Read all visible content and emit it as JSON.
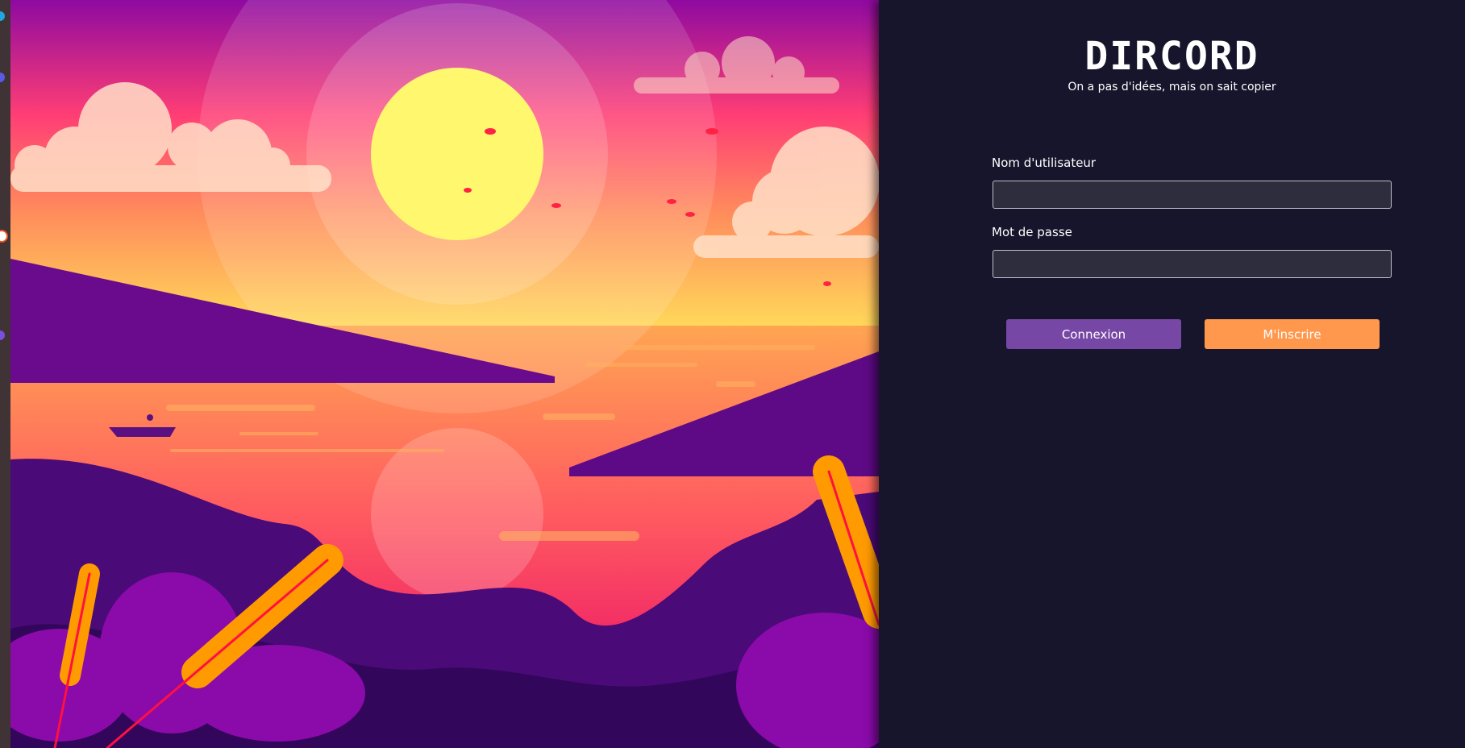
{
  "app": {
    "title": "DIRCORD",
    "tagline": "On a pas d'idées, mais on sait copier"
  },
  "login_form": {
    "username_label": "Nom d'utilisateur",
    "username_value": "",
    "password_label": "Mot de passe",
    "password_value": "",
    "login_button": "Connexion",
    "register_button": "M'inscrire"
  },
  "colors": {
    "panel_bg": "#16152b",
    "login_button": "#7747a5",
    "register_button": "#ff974c"
  }
}
